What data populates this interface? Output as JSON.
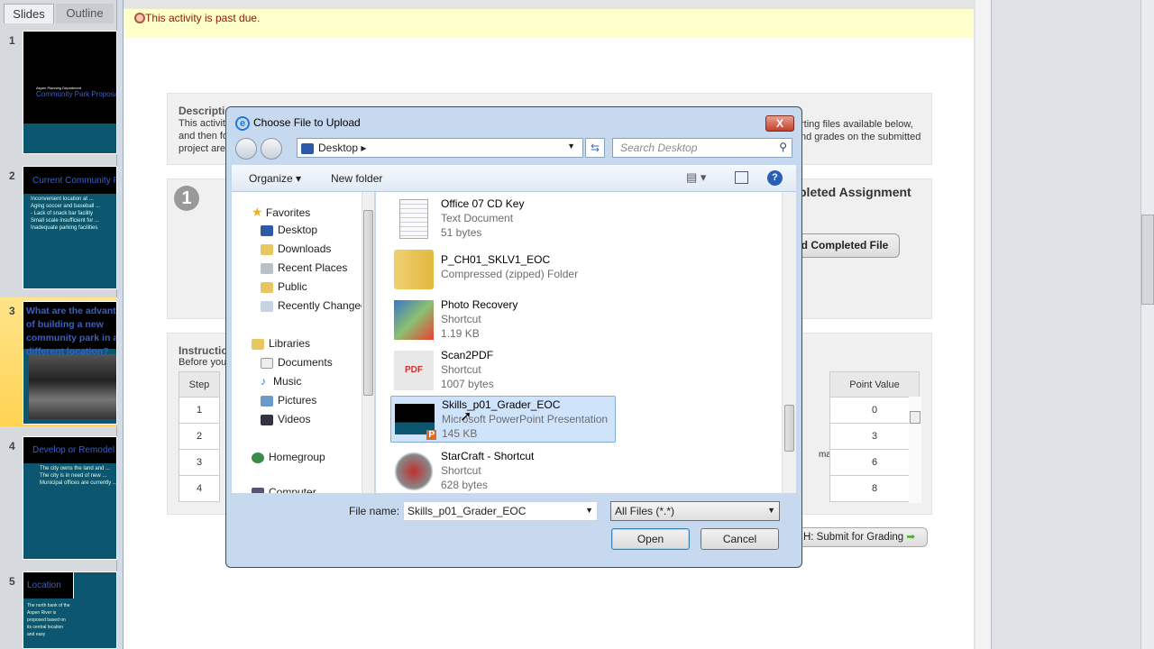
{
  "slides_pane": {
    "tabs": [
      "Slides",
      "Outline"
    ],
    "slides": [
      {
        "number": "1",
        "subtitle": "Aspen Planning Department",
        "title": "Community Park Proposal"
      },
      {
        "number": "2",
        "title": "Current Community Park",
        "bullets": [
          "Inconvenient location at ...",
          "Aging soccer and baseball ...",
          "- Lack of snack bar facility",
          "Small scale insufficient for ...",
          "Inadequate parking facilities"
        ]
      },
      {
        "number": "3",
        "title": "What are the advantages of building a new community park in a different location?"
      },
      {
        "number": "4",
        "title": "Develop or Remodel",
        "bullets": [
          "The city owns the land and ...",
          "The city is in need of new ...",
          "Municipal offices are currently ..."
        ]
      },
      {
        "number": "5",
        "title": "Location",
        "body": "The north bank of the Aspen River is proposed based on its central location and easy"
      }
    ]
  },
  "page": {
    "past_due": "This activity is past due.",
    "description_heading": "Descriptio",
    "description_lines": [
      "This activity",
      "and then fo",
      "project are"
    ],
    "description_right": [
      "rting files available below,",
      "nd grades on the submitted"
    ],
    "step_number": "1",
    "upload_heading": "pleted Assignment",
    "upload_button": "d Completed File",
    "instructions_heading": "Instructio",
    "instructions_text": "Before you",
    "table": {
      "headers": [
        "Step",
        "Point Value"
      ],
      "rows": [
        {
          "step": "1",
          "desc": "",
          "points": "0"
        },
        {
          "step": "2",
          "desc": "",
          "points": "3"
        },
        {
          "step": "3",
          "desc": "mall",
          "points": "6"
        },
        {
          "step": "4",
          "desc": "",
          "points": "8"
        }
      ]
    },
    "submit_button": "H: Submit for Grading"
  },
  "dialog": {
    "title": "Choose File to Upload",
    "close": "X",
    "address": "Desktop",
    "search_placeholder": "Search Desktop",
    "organize": "Organize ▾",
    "new_folder": "New folder",
    "nav": {
      "favorites": "Favorites",
      "fav_items": [
        "Desktop",
        "Downloads",
        "Recent Places",
        "Public",
        "Recently Changed"
      ],
      "libraries": "Libraries",
      "lib_items": [
        "Documents",
        "Music",
        "Pictures",
        "Videos"
      ],
      "homegroup": "Homegroup",
      "computer": "Computer"
    },
    "files": [
      {
        "name": "Office 07 CD Key",
        "type": "Text Document",
        "size": "51 bytes"
      },
      {
        "name": "P_CH01_SKLV1_EOC",
        "type": "Compressed (zipped) Folder",
        "size": ""
      },
      {
        "name": "Photo Recovery",
        "type": "Shortcut",
        "size": "1.19 KB"
      },
      {
        "name": "Scan2PDF",
        "type": "Shortcut",
        "size": "1007 bytes"
      },
      {
        "name": "Skills_p01_Grader_EOC",
        "type": "Microsoft PowerPoint Presentation",
        "size": "145 KB"
      },
      {
        "name": "StarCraft - Shortcut",
        "type": "Shortcut",
        "size": "628 bytes"
      }
    ],
    "file_name_label": "File name:",
    "file_name_value": "Skills_p01_Grader_EOC",
    "file_type": "All Files (*.*)",
    "open": "Open",
    "cancel": "Cancel"
  }
}
